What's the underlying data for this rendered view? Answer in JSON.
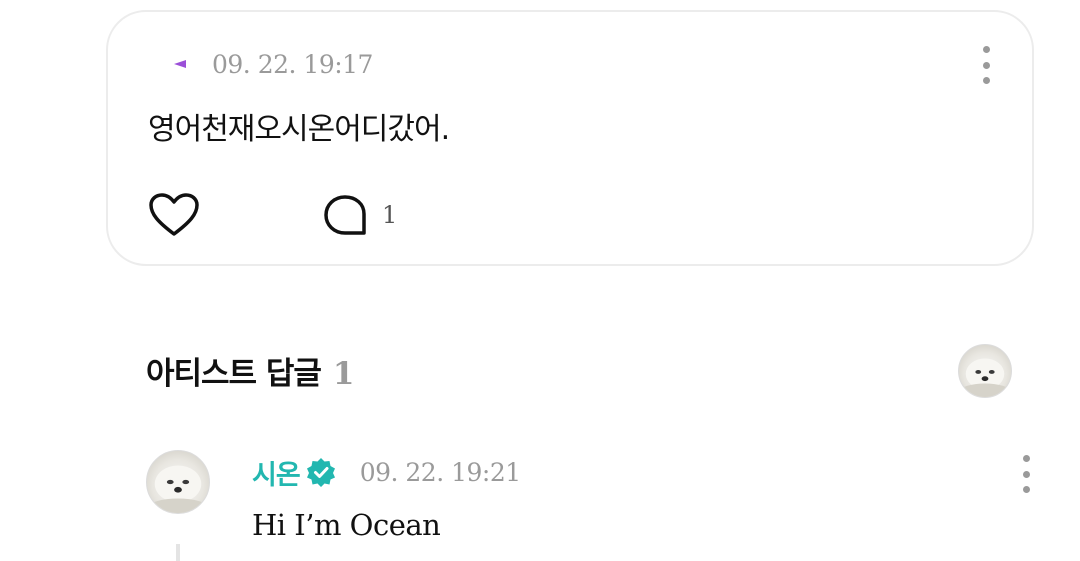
{
  "post": {
    "timestamp": "09. 22. 19:17",
    "body": "영어천재오시온어디갔어.",
    "comment_count": "1"
  },
  "artist_replies": {
    "title": "아티스트 답글",
    "count": "1"
  },
  "reply": {
    "author": "시온",
    "timestamp": "09. 22. 19:21",
    "body": "Hi I’m Ocean"
  },
  "colors": {
    "accent": "#22b7b0",
    "muted": "#9a9a9a",
    "card_border": "#ececec",
    "mark": "#9b4fd8"
  },
  "icons": {
    "like": "heart-outline-icon",
    "comment": "speech-bubble-icon",
    "more": "vertical-dots-icon",
    "verified": "verified-badge-icon"
  }
}
